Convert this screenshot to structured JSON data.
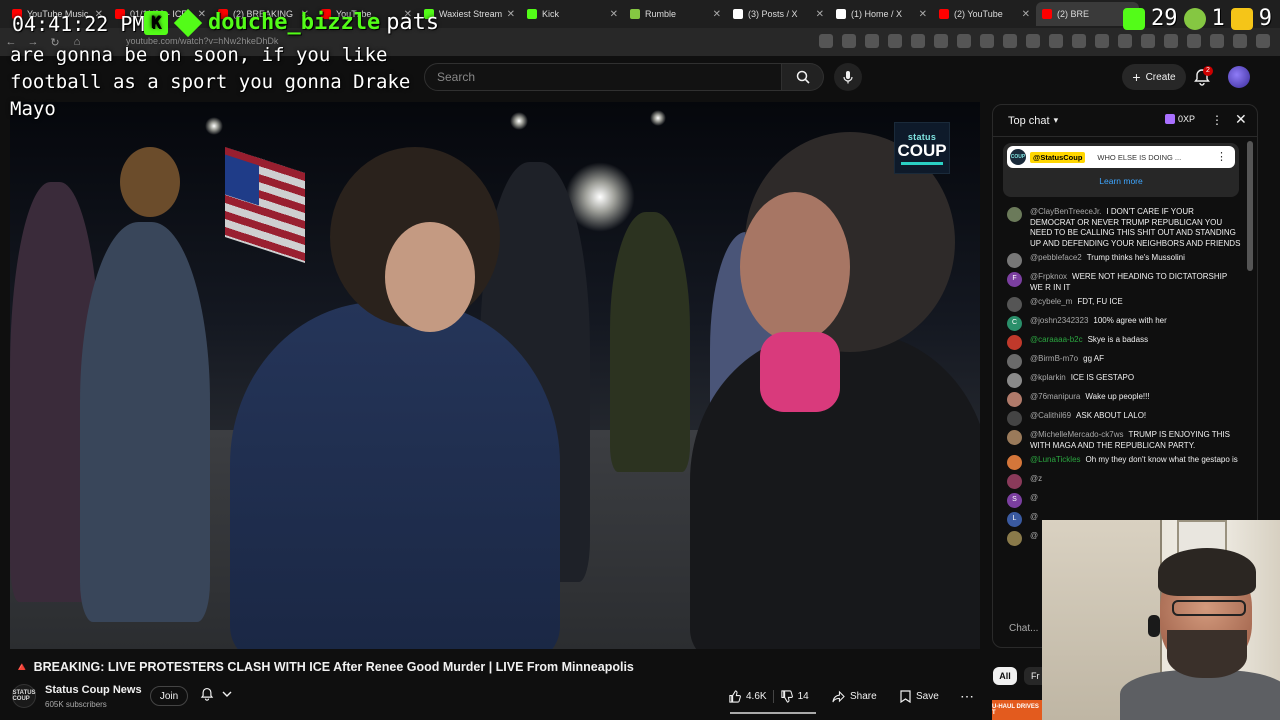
{
  "browser": {
    "tabs": [
      {
        "label": "YouTube Music",
        "color": "#ff0000",
        "active": false
      },
      {
        "label": "01/11/26 - ICE",
        "color": "#ff0000",
        "active": false
      },
      {
        "label": "(2) BREAKING",
        "color": "#ff0000",
        "active": false
      },
      {
        "label": "YouTube",
        "color": "#ff0000",
        "active": false
      },
      {
        "label": "Waxiest Stream",
        "color": "#53fc18",
        "active": false
      },
      {
        "label": "Kick",
        "color": "#53fc18",
        "active": false
      },
      {
        "label": "Rumble",
        "color": "#85c742",
        "active": false
      },
      {
        "label": "(3) Posts / X",
        "color": "#ffffff",
        "active": false
      },
      {
        "label": "(1) Home / X",
        "color": "#ffffff",
        "active": false
      },
      {
        "label": "(2) YouTube",
        "color": "#ff0000",
        "active": false
      },
      {
        "label": "(2) BRE",
        "color": "#ff0000",
        "active": true
      }
    ],
    "url": "youtube.com/watch?v=hNw2hkeDhDk"
  },
  "overlay": {
    "clock": "04:41:22 PM",
    "chat_username": "douche_bizzle",
    "chat_message_inline": "pats",
    "chat_message": "are gonna be on soon, if you like football as a sport you gonna Drake Mayo",
    "stat_1": "29",
    "stat_2": "1",
    "stat_3": "9"
  },
  "youtube": {
    "search_placeholder": "Search",
    "create_label": "Create",
    "notification_count": "2"
  },
  "video": {
    "watermark_top": "status",
    "watermark_bottom": "COUP"
  },
  "video_meta": {
    "title": "BREAKING: LIVE PROTESTERS CLASH WITH ICE After Renee Good Murder | LIVE From Minneapolis",
    "channel_name": "Status Coup News",
    "channel_avatar_text": "STATUS COUP",
    "subscribers": "605K subscribers",
    "join_label": "Join",
    "like_count": "4.6K",
    "dislike_count": "14",
    "share_label": "Share",
    "save_label": "Save"
  },
  "chat": {
    "header_title": "Top chat",
    "xp_label": "0XP",
    "pinned": {
      "author": "@StatusCoup",
      "avatar_text": "COUP",
      "text": "WHO ELSE IS DOING ...",
      "learn_more": "Learn more"
    },
    "messages": [
      {
        "author": "@ClayBenTreeceJr.",
        "text": "I DON'T CARE IF YOUR DEMOCRAT OR NEVER TRUMP REPUBLICAN YOU NEED TO BE CALLING THIS SHIT OUT AND STANDING UP AND DEFENDING YOUR NEIGHBORS AND FRIENDS",
        "avatar": "",
        "avatar_color": "#6b7a5a",
        "role": "normal"
      },
      {
        "author": "@pebbleface2",
        "text": "Trump thinks he's Mussolini",
        "avatar": "",
        "avatar_color": "#777777",
        "role": "normal"
      },
      {
        "author": "@Frpknox",
        "text": "WERE NOT HEADING TO DICTATORSHIP WE R IN IT",
        "avatar": "F",
        "avatar_color": "#7b3fa0",
        "role": "normal"
      },
      {
        "author": "@cybele_m",
        "text": "FDT, FU ICE",
        "avatar": "",
        "avatar_color": "#555555",
        "role": "normal"
      },
      {
        "author": "@joshn2342323",
        "text": "100% agree with her",
        "avatar": "C",
        "avatar_color": "#2a8f6a",
        "role": "normal"
      },
      {
        "author": "@caraaaa-b2c",
        "text": "Skye is a badass",
        "avatar": "",
        "avatar_color": "#c0392b",
        "role": "member"
      },
      {
        "author": "@BirmB-m7o",
        "text": "gg AF",
        "avatar": "",
        "avatar_color": "#6a6a6a",
        "role": "normal"
      },
      {
        "author": "@kplarkin",
        "text": "ICE IS GESTAPO",
        "avatar": "",
        "avatar_color": "#8a8a8a",
        "role": "normal"
      },
      {
        "author": "@76manipura",
        "text": "Wake up people!!!",
        "avatar": "",
        "avatar_color": "#b07a6a",
        "role": "normal"
      },
      {
        "author": "@Calithil69",
        "text": "ASK ABOUT LALO!",
        "avatar": "",
        "avatar_color": "#444444",
        "role": "normal"
      },
      {
        "author": "@MichelleMercado-ck7ws",
        "text": "TRUMP IS ENJOYING THIS WITH MAGA AND THE REPUBLICAN PARTY.",
        "avatar": "",
        "avatar_color": "#9a7a5a",
        "role": "normal"
      },
      {
        "author": "@LunaTickles",
        "text": "Oh my they don't know what the gestapo is",
        "avatar": "",
        "avatar_color": "#d4763a",
        "role": "mod"
      },
      {
        "author": "@z",
        "text": "",
        "avatar": "",
        "avatar_color": "#8a3a5a",
        "role": "normal"
      },
      {
        "author": "@",
        "text": "",
        "avatar": "S",
        "avatar_color": "#7b3fa0",
        "role": "normal"
      },
      {
        "author": "@",
        "text": "",
        "avatar": "L",
        "avatar_color": "#3a5aa0",
        "role": "normal"
      },
      {
        "author": "@",
        "text": "",
        "avatar": "",
        "avatar_color": "#8a7a4a",
        "role": "normal"
      }
    ],
    "input_placeholder": "Chat...",
    "chips": {
      "all": "All",
      "friends": "Fr"
    }
  },
  "ad": {
    "text": "U-HAUL DRIVES T"
  }
}
